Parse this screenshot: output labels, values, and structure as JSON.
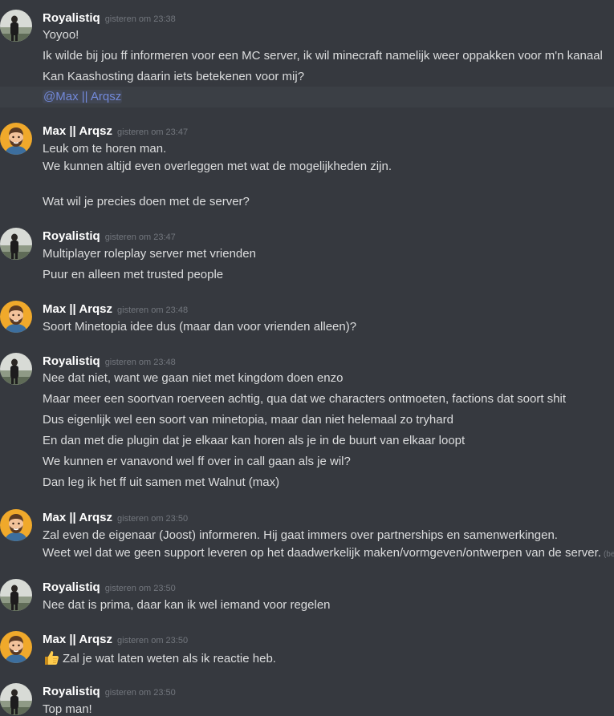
{
  "users": {
    "royal": {
      "name": "Royalistiq"
    },
    "max": {
      "name": "Max || Arqsz"
    }
  },
  "groups": [
    {
      "author": "Royalistiq",
      "time": "gisteren om 23:38",
      "lines": [
        "Yoyoo!",
        "Ik wilde bij jou ff informeren voor een MC server, ik wil minecraft namelijk weer oppakken voor m'n kanaal",
        "Kan Kaashosting daarin iets betekenen voor mij?"
      ],
      "mention": "@Max || Arqsz"
    },
    {
      "author": "Max || Arqsz",
      "time": "gisteren om 23:47",
      "lines": [
        "Leuk om te horen man.",
        "We kunnen altijd even overleggen met wat de mogelijkheden zijn.",
        "",
        "Wat wil je precies doen met de server?"
      ]
    },
    {
      "author": "Royalistiq",
      "time": "gisteren om 23:47",
      "lines": [
        "Multiplayer roleplay server met vrienden",
        "Puur en alleen met trusted people"
      ]
    },
    {
      "author": "Max || Arqsz",
      "time": "gisteren om 23:48",
      "lines": [
        "Soort Minetopia idee dus (maar dan voor vrienden alleen)?"
      ]
    },
    {
      "author": "Royalistiq",
      "time": "gisteren om 23:48",
      "lines": [
        "Nee dat niet, want we gaan niet met kingdom doen enzo",
        "Maar meer een soortvan roerveen achtig, qua dat we characters ontmoeten, factions dat soort shit",
        "Dus eigenlijk wel een soort van minetopia, maar dan niet helemaal zo tryhard",
        "En dan met die plugin dat je elkaar kan horen als je in de buurt van elkaar loopt",
        "We kunnen er vanavond wel ff over in call gaan als je wil?",
        "Dan leg ik het ff uit samen met Walnut (max)"
      ]
    },
    {
      "author": "Max || Arqsz",
      "time": "gisteren om 23:50",
      "lines": [
        "Zal even de eigenaar (Joost) informeren. Hij gaat immers over partnerships en samenwerkingen.",
        "Weet wel dat we geen support leveren op het daadwerkelijk maken/vormgeven/ontwerpen van de server."
      ],
      "edited": "(bewerkt)"
    },
    {
      "author": "Royalistiq",
      "time": "gisteren om 23:50",
      "lines": [
        "Nee dat is prima, daar kan ik wel iemand voor regelen"
      ]
    },
    {
      "author": "Max || Arqsz",
      "time": "gisteren om 23:50",
      "lines": [
        "Zal je wat laten weten als ik reactie heb."
      ],
      "emoji": "thumbs-up-icon"
    },
    {
      "author": "Royalistiq",
      "time": "gisteren om 23:50",
      "lines": [
        "Top man!"
      ]
    }
  ],
  "colors": {
    "background": "#36393f",
    "author": "#ffffff",
    "text": "#dcddde",
    "timestamp": "#72767d",
    "mention": "#7289da",
    "mention_row": "#3b3f45",
    "max_avatar_bg": "#f0a92b"
  }
}
